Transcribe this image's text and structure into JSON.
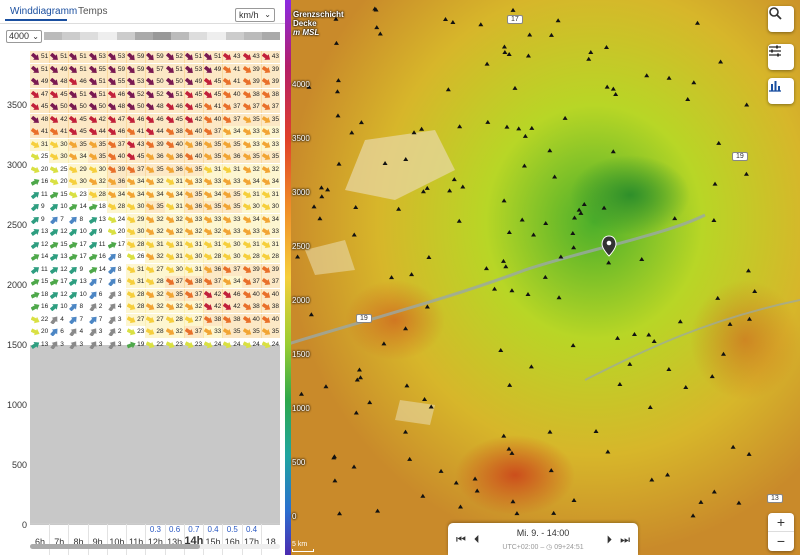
{
  "tabs": {
    "wind": "Winddiagramm",
    "temps": "Temps"
  },
  "unit": "km/h",
  "altitude_select": "4000",
  "y_ticks": [
    "0",
    "500",
    "1000",
    "1500",
    "2000",
    "2500",
    "3000",
    "3500"
  ],
  "hours": [
    "6h",
    "7h",
    "8h",
    "9h",
    "10h",
    "11h",
    "12h",
    "13h",
    "14h",
    "15h",
    "16h",
    "17h",
    "18"
  ],
  "current_hour": "14h",
  "precip": [
    "",
    "",
    "",
    "",
    "",
    "",
    "0.3",
    "0.6",
    "0.7",
    "0.4",
    "0.5",
    "0.4",
    ""
  ],
  "wind_rows": [
    [
      51,
      51,
      51,
      53,
      53,
      59,
      59,
      52,
      51,
      51,
      43,
      43,
      43
    ],
    [
      51,
      49,
      51,
      55,
      59,
      59,
      57,
      51,
      53,
      49,
      41,
      39,
      39
    ],
    [
      49,
      48,
      46,
      51,
      55,
      53,
      50,
      50,
      49,
      45,
      41,
      39,
      39
    ],
    [
      47,
      45,
      51,
      51,
      46,
      52,
      52,
      51,
      45,
      45,
      40,
      38,
      38
    ],
    [
      45,
      50,
      50,
      50,
      48,
      50,
      48,
      46,
      45,
      41,
      37,
      37,
      37
    ],
    [
      48,
      42,
      45,
      42,
      47,
      46,
      46,
      45,
      42,
      40,
      37,
      35,
      35
    ],
    [
      41,
      41,
      45,
      44,
      46,
      41,
      44,
      38,
      40,
      37,
      34,
      33,
      33
    ],
    [
      31,
      30,
      35,
      35,
      37,
      43,
      39,
      40,
      36,
      35,
      35,
      33,
      33
    ],
    [
      25,
      30,
      34,
      35,
      40,
      45,
      36,
      36,
      40,
      35,
      36,
      35,
      35
    ],
    [
      20,
      25,
      29,
      30,
      39,
      37,
      35,
      36,
      35,
      31,
      31,
      32,
      32
    ],
    [
      16,
      20,
      30,
      32,
      36,
      34,
      32,
      31,
      33,
      33,
      33,
      34,
      34
    ],
    [
      11,
      15,
      23,
      28,
      34,
      34,
      34,
      34,
      35,
      34,
      35,
      31,
      31
    ],
    [
      9,
      10,
      14,
      18,
      28,
      30,
      35,
      31,
      36,
      35,
      35,
      30,
      30
    ],
    [
      9,
      7,
      8,
      13,
      24,
      29,
      32,
      32,
      33,
      33,
      33,
      34,
      34
    ],
    [
      13,
      12,
      10,
      9,
      20,
      30,
      32,
      32,
      32,
      32,
      33,
      33,
      33
    ],
    [
      12,
      15,
      17,
      11,
      17,
      28,
      31,
      31,
      31,
      31,
      30,
      31,
      31
    ],
    [
      14,
      13,
      17,
      16,
      8,
      26,
      32,
      31,
      30,
      28,
      30,
      28,
      28
    ],
    [
      11,
      12,
      9,
      14,
      8,
      31,
      27,
      30,
      31,
      36,
      37,
      39,
      39
    ],
    [
      15,
      17,
      13,
      7,
      6,
      31,
      28,
      37,
      38,
      37,
      34,
      37,
      37
    ],
    [
      18,
      12,
      10,
      6,
      3,
      28,
      32,
      35,
      37,
      42,
      46,
      40,
      40
    ],
    [
      16,
      10,
      8,
      2,
      4,
      28,
      32,
      32,
      32,
      42,
      42,
      38,
      38
    ],
    [
      22,
      4,
      7,
      7,
      3,
      27,
      27,
      28,
      27,
      38,
      38,
      40,
      40
    ],
    [
      20,
      6,
      4,
      3,
      2,
      23,
      28,
      32,
      37,
      33,
      35,
      35,
      35
    ],
    [
      13,
      3,
      3,
      3,
      3,
      19,
      22,
      23,
      23,
      24,
      24,
      24,
      24
    ]
  ],
  "terrain_top_altitude": 1500,
  "map": {
    "layer_title": "Grenzschicht Decke",
    "layer_unit": "m MSL",
    "scale_labels": [
      "4000",
      "3500",
      "3000",
      "2500",
      "2000",
      "1500",
      "1000",
      "500",
      "0"
    ],
    "road_badges": [
      "17",
      "19",
      "19",
      "13"
    ],
    "timebar_label": "Mi. 9. - 14:00",
    "timebar_sub": "UTC+02:00 – ◷ 09+24:51",
    "scale_label": "5 km",
    "zoom_in": "+",
    "zoom_out": "−"
  },
  "colors": {
    "accent": "#1a4fa0",
    "precip": "#2b59c3",
    "terrain": "#c8c8c8"
  }
}
